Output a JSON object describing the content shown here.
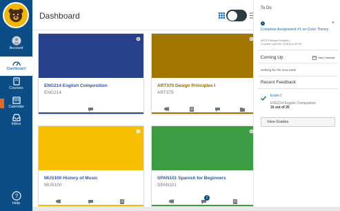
{
  "colors": {
    "nav": "#0b4d86",
    "accent_link": "#0b6cbd",
    "card_eng": "#27408b",
    "card_art": "#a07600",
    "card_mus": "#f7bf00",
    "card_span": "#3c9c41"
  },
  "nav": {
    "items": [
      {
        "label": "Account"
      },
      {
        "label": "Dashboard"
      },
      {
        "label": "Courses"
      },
      {
        "label": "Calendar"
      },
      {
        "label": "Inbox"
      },
      {
        "label": "Help"
      }
    ]
  },
  "header": {
    "title": "Dashboard"
  },
  "cards": [
    {
      "name": "ENG214 English Composition",
      "code": "ENG214",
      "name_color": "#2d56a3",
      "icons": [
        "discussions"
      ]
    },
    {
      "name": "ART375 Design Principles I",
      "code": "ART375",
      "name_color": "#8a6500",
      "icons": [
        "announcements",
        "assignments",
        "discussions",
        "files"
      ]
    },
    {
      "name": "MUS100 History of Music",
      "code": "MUS100",
      "name_color": "#2d56a3",
      "icons": [
        "announcements",
        "discussions",
        "assignments"
      ]
    },
    {
      "name": "SPAN101 Spanish for Beginners",
      "code": "SPAN101",
      "name_color": "#2d56a3",
      "icons": [
        "announcements",
        "discussions",
        "assignments"
      ],
      "badge": "1"
    }
  ],
  "sidebar": {
    "todo_heading": "To Do",
    "todo_count": "1",
    "todo_dismiss": "×",
    "todo_title": "Complete Assignment #1 on Color Theory",
    "todo_course": "ART375 Design Principles I",
    "todo_due": "10 points • April 6th, 2018 at 11:59 PM",
    "coming_up": "Coming Up",
    "view_calendar": "View Calendar",
    "nothing": "Nothing for the next week",
    "recent_feedback": "Recent Feedback",
    "feedback_title": "Exam 1",
    "feedback_course": "ENG214 English Composition",
    "feedback_score": "16 out of 25",
    "view_grades": "View Grades"
  }
}
